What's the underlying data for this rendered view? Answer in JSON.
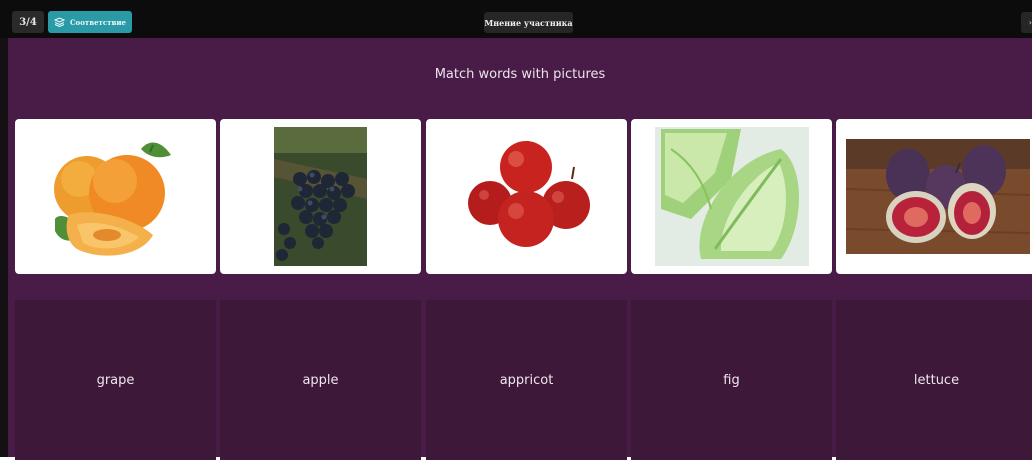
{
  "topbar": {
    "step": "3/4",
    "mode_label": "Соответствие",
    "mode_icon": "layers-icon",
    "participant_label": "Мнение участника",
    "right_glyph": "›"
  },
  "activity": {
    "instruction": "Match words with pictures",
    "pictures": [
      {
        "name": "apricot-picture",
        "depicts": "apricots"
      },
      {
        "name": "grape-picture",
        "depicts": "grapes"
      },
      {
        "name": "apple-picture",
        "depicts": "apples"
      },
      {
        "name": "lettuce-picture",
        "depicts": "lettuce"
      },
      {
        "name": "fig-picture",
        "depicts": "figs"
      }
    ],
    "words": [
      "grape",
      "apple",
      "appricot",
      "fig",
      "lettuce"
    ]
  },
  "colors": {
    "topbar": "#0c0c0c",
    "accent": "#2a9aa6",
    "stage": "#481c46",
    "word_tile": "#3d1839"
  }
}
